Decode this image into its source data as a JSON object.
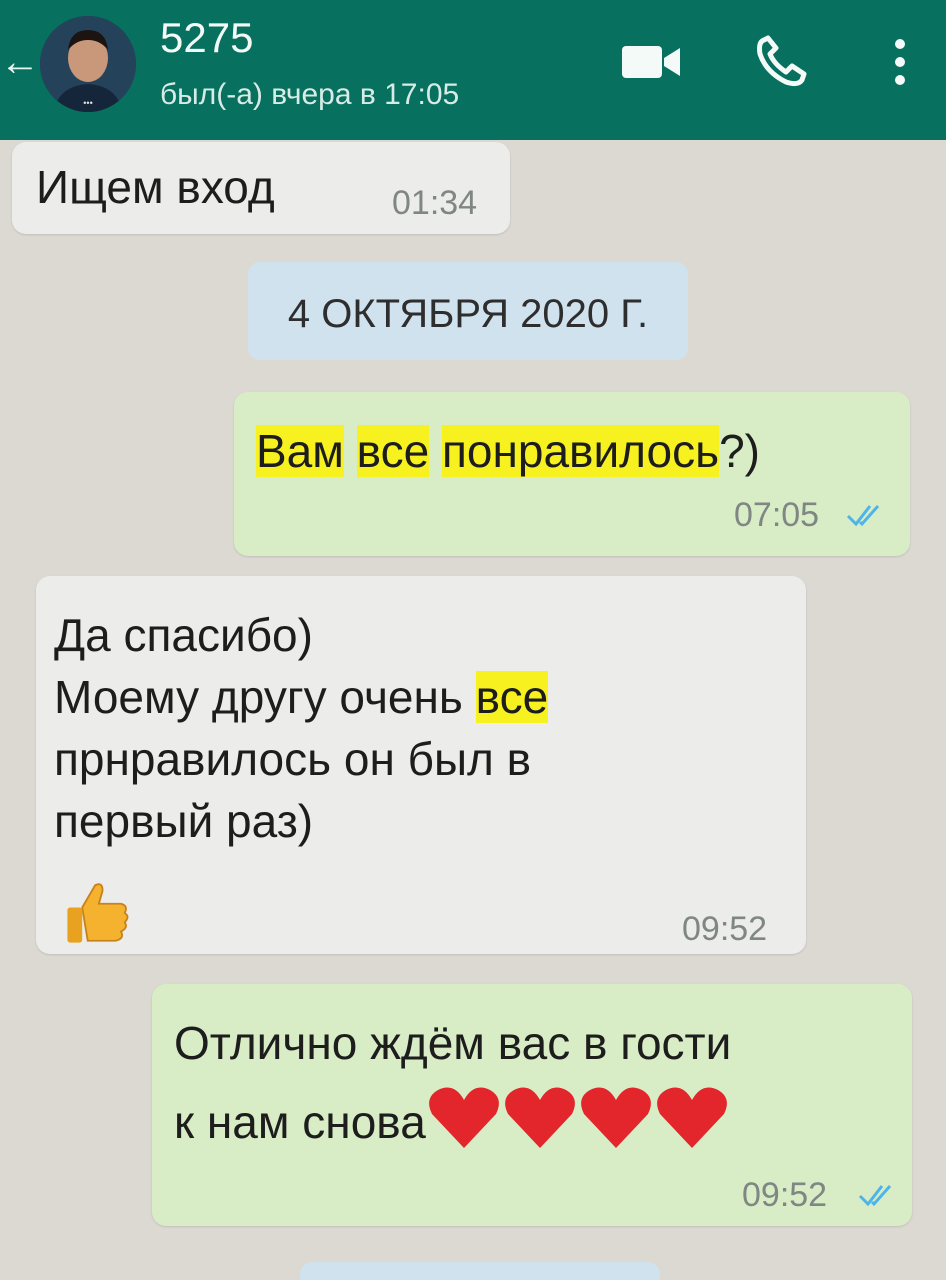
{
  "header": {
    "contact_name": "5275",
    "status": "был(-а) вчера в 17:05",
    "back_icon": "arrow-left-icon",
    "video_icon": "video-call-icon",
    "call_icon": "phone-icon",
    "more_icon": "more-vertical-icon"
  },
  "messages": [
    {
      "direction": "in",
      "text": "Ищем вход",
      "time": "01:34"
    },
    {
      "direction": "out",
      "words": [
        "Вам",
        "все",
        "понравилось",
        "?)"
      ],
      "time": "07:05",
      "status": "read"
    },
    {
      "direction": "in",
      "lines": [
        "Да спасибо)",
        "Моему другу очень",
        "все",
        "прнравилось он был в",
        "первый раз)"
      ],
      "emoji": "thumbs-up-icon",
      "time": "09:52"
    },
    {
      "direction": "out",
      "lines": [
        "Отлично ждём вас в гости",
        "к нам снова"
      ],
      "emoji": "red-heart-icon",
      "time": "09:52",
      "status": "read"
    }
  ],
  "date_separator": "4 ОКТЯБРЯ 2020 Г.",
  "colors": {
    "header": "#07705f",
    "incoming_bubble": "#ececea",
    "outgoing_bubble": "#d8edc5",
    "highlight": "#f7f21f",
    "read_tick": "#4fb4e8"
  }
}
